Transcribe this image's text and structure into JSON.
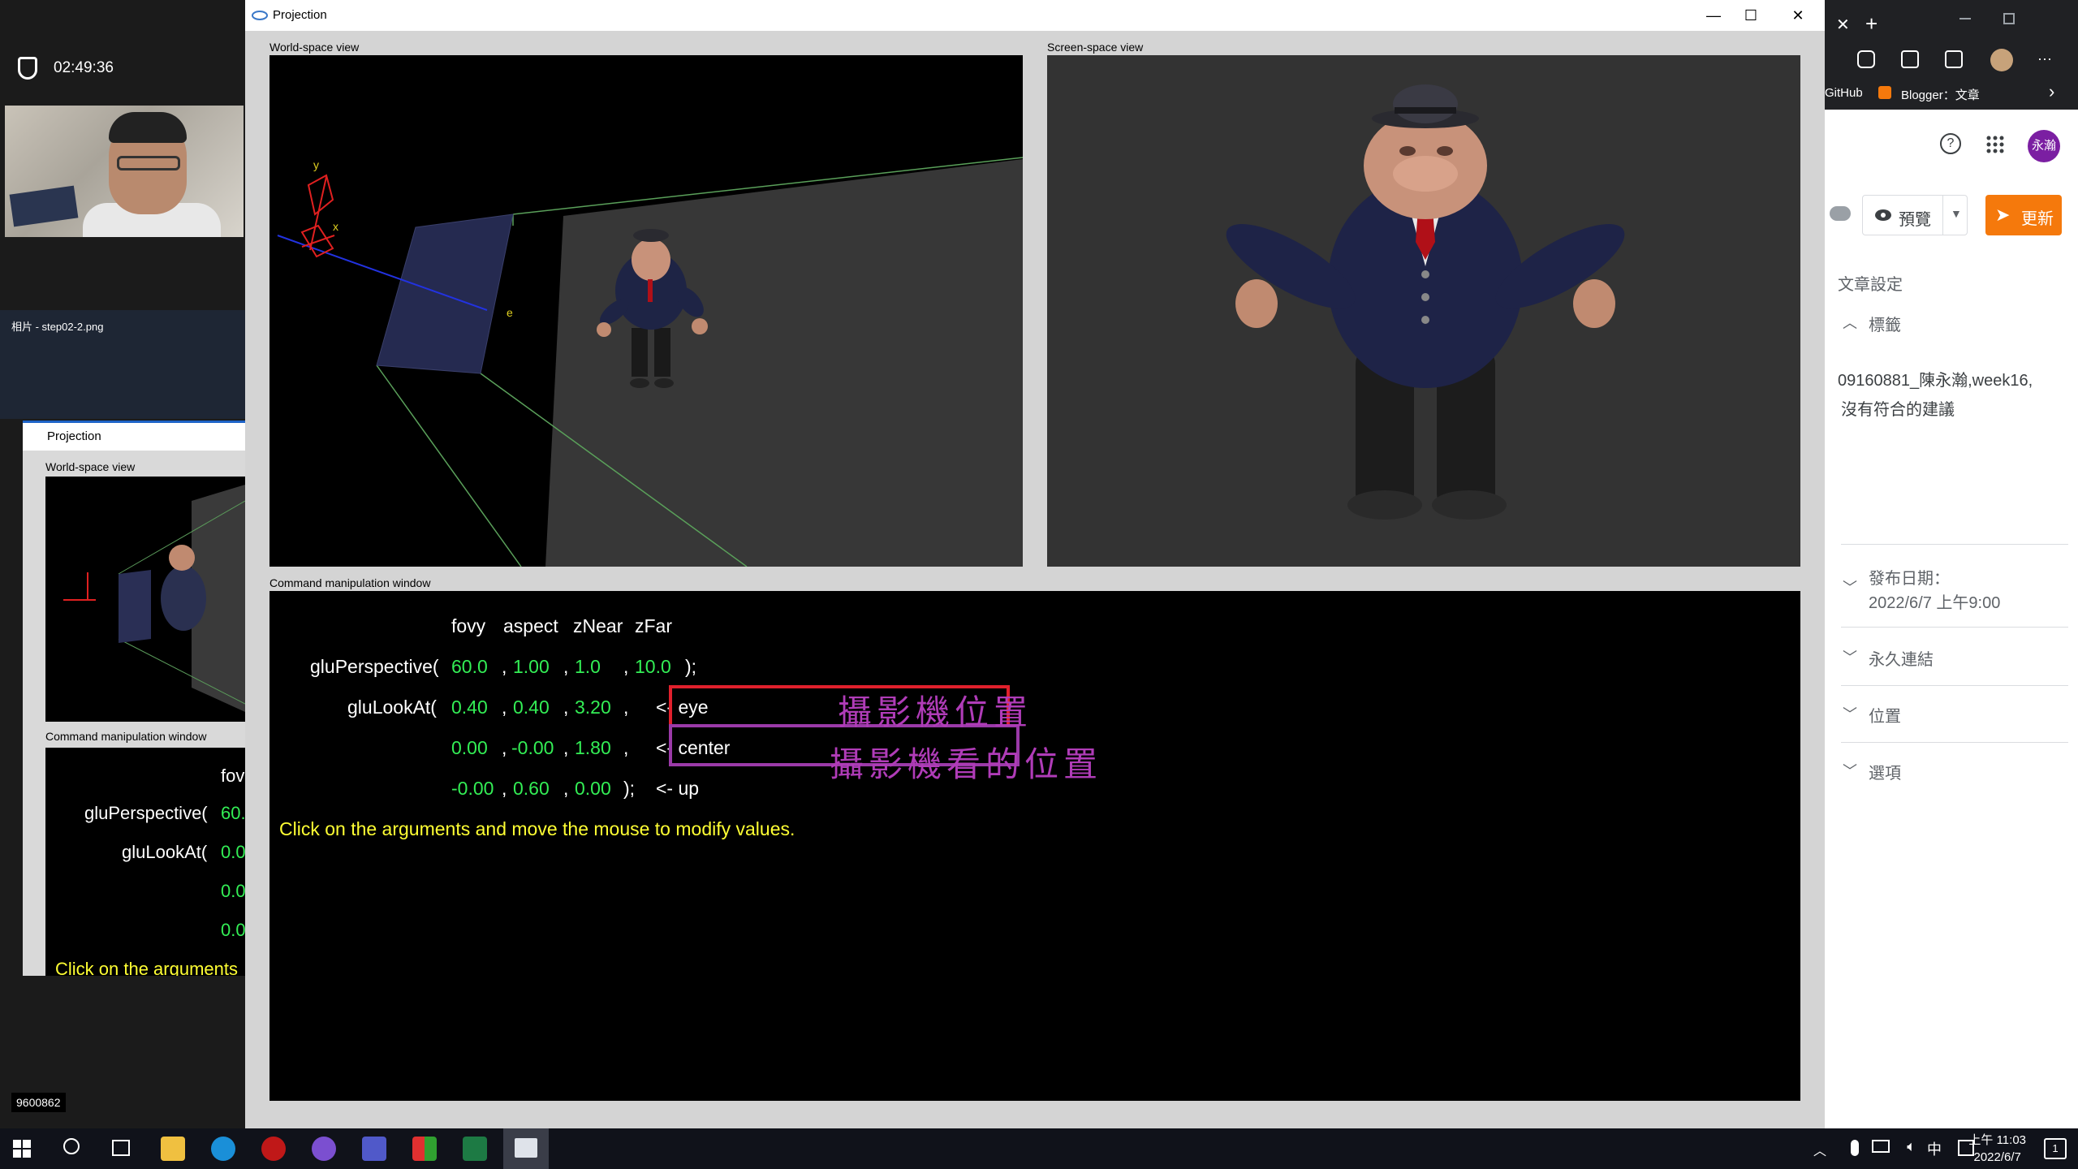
{
  "left_panel": {
    "call_timer": "02:49:36",
    "photo_filename": "相片 - step02-2.png",
    "caller_id": "9600862",
    "mini_window": {
      "title": "Projection",
      "world_label": "World-space view",
      "cmd_label": "Command manipulation window",
      "rows": [
        "fov",
        "gluPerspective(",
        "60.",
        "gluLookAt(",
        "0.0",
        "0.0",
        "0.0",
        "Click on the arguments"
      ]
    }
  },
  "main_window": {
    "title": "Projection",
    "controls": {
      "minimize": "—",
      "maximize": "☐",
      "close": "✕"
    },
    "world_label": "World-space view",
    "screen_label": "Screen-space view",
    "cmd_label": "Command manipulation window",
    "axis_labels": {
      "y": "y",
      "x": "x",
      "e": "e"
    },
    "command": {
      "header": {
        "fovy": "fovy",
        "aspect": "aspect",
        "znear": "zNear",
        "zfar": "zFar"
      },
      "perspective": {
        "fn": "gluPerspective(",
        "fovy": "60.0",
        "sep1": ",",
        "aspect": "1.00",
        "sep2": ",",
        "znear": "1.0",
        "sep3": ",",
        "zfar": "10.0",
        "end": ");"
      },
      "lookat_eye": {
        "fn": "gluLookAt(",
        "x": "0.40",
        "sep1": ",",
        "y": "0.40",
        "sep2": ",",
        "z": "3.20",
        "sep3": ",",
        "tag": "<- eye"
      },
      "lookat_center": {
        "x": "0.00",
        "sep1": ",",
        "y": "-0.00",
        "sep2": ",",
        "z": "1.80",
        "sep3": ",",
        "tag": "<- center"
      },
      "lookat_up": {
        "x": "-0.00",
        "sep1": ",",
        "y": "0.60",
        "sep2": ",",
        "z": "0.00",
        "end": ");",
        "tag": "<- up"
      },
      "hint": "Click on the arguments and move the mouse to modify values."
    },
    "annotations": {
      "eye_note": "攝影機位置",
      "center_note": "攝影機看的位置"
    }
  },
  "right_panel": {
    "browser": {
      "close_tab": "✕",
      "new_tab": "+",
      "bookmark1": "GitHub",
      "bookmark2": "Blogger：文章",
      "more": "···",
      "chevron": "›"
    },
    "avatar_text": "永瀚",
    "help": "?",
    "preview_label": "預覽",
    "update_label": "更新",
    "post_settings": "文章設定",
    "labels_heading": "標籤",
    "labels_value": "09160881_陳永瀚,week16,",
    "labels_suggestion": "沒有符合的建議",
    "publish_date_label": "發布日期：",
    "publish_date_value": "2022/6/7 上午9:00",
    "permalink": "永久連結",
    "location": "位置",
    "options": "選項"
  },
  "taskbar": {
    "time": "上午 11:03",
    "date": "2022/6/7",
    "ime": "中",
    "notification_count": "1"
  },
  "colors": {
    "accent_orange": "#f5790c",
    "code_green": "#33ee55",
    "hint_yellow": "#ffff33",
    "box_red": "#e0202c",
    "box_purple": "#9b3aa8",
    "annotation_purple": "#b03cb8"
  }
}
